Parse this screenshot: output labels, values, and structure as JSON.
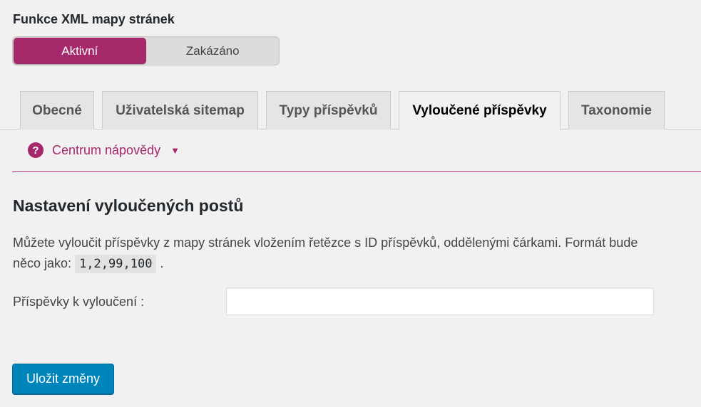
{
  "feature": {
    "title": "Funkce XML mapy stránek",
    "switch": {
      "active_label": "Aktivní",
      "inactive_label": "Zakázáno",
      "selected": "Aktivní"
    }
  },
  "tabs": [
    {
      "label": "Obecné",
      "active": false
    },
    {
      "label": "Uživatelská sitemap",
      "active": false
    },
    {
      "label": "Typy příspěvků",
      "active": false
    },
    {
      "label": "Vyloučené příspěvky",
      "active": true
    },
    {
      "label": "Taxonomie",
      "active": false
    }
  ],
  "help": {
    "icon": "question-circle-icon",
    "label": "Centrum nápovědy",
    "caret": "▼"
  },
  "section": {
    "title": "Nastavení vyloučených postů",
    "description_before": "Můžete vyloučit příspěvky z mapy stránek vložením řetězce s ID příspěvků, oddělenými čárkami. Formát bude něco jako:",
    "code_example": "1,2,99,100",
    "description_after": "."
  },
  "field": {
    "label": "Příspěvky k vyloučení :",
    "value": "",
    "placeholder": ""
  },
  "save_button": {
    "label": "Uložit změny"
  },
  "colors": {
    "accent": "#a4286a",
    "primary_button": "#0085ba",
    "background": "#f1f1f1"
  }
}
